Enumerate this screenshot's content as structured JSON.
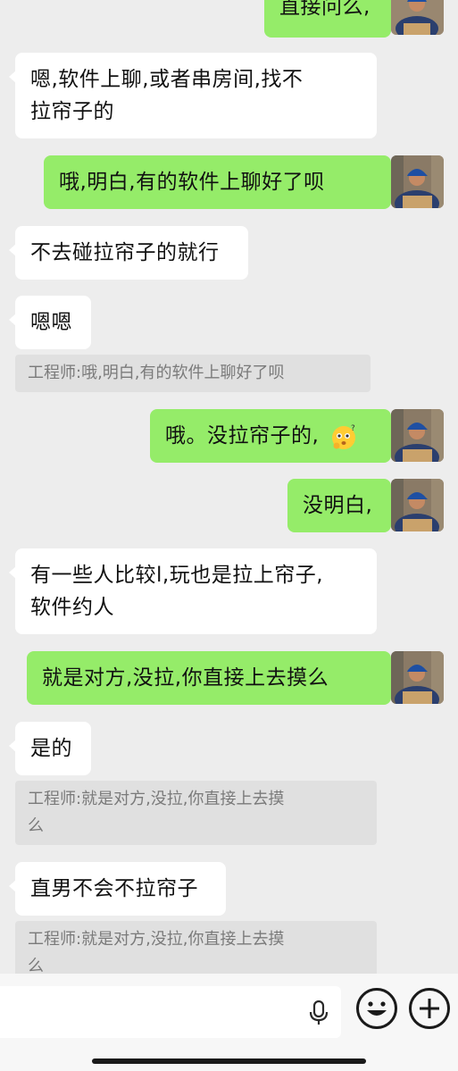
{
  "contacts": {
    "self_avatar": "person-with-blue-cap-holding-box-avatar"
  },
  "messages": [
    {
      "side": "out",
      "text": "直接问么,"
    },
    {
      "side": "in",
      "line1": "嗯,软件上聊,或者串房间,找不",
      "line2": "拉帘子的"
    },
    {
      "side": "out",
      "text": "哦,明白,有的软件上聊好了呗"
    },
    {
      "side": "in",
      "text": "不去碰拉帘子的就行"
    },
    {
      "side": "in",
      "text": "嗯嗯",
      "quote": "工程师:哦,明白,有的软件上聊好了呗"
    },
    {
      "side": "out",
      "text": "哦。没拉帘子的,",
      "emoji": "thinking-face-emoji"
    },
    {
      "side": "out",
      "text": "没明白,"
    },
    {
      "side": "in",
      "line1": "有一些人比较l,玩也是拉上帘子,",
      "line2": "软件约人"
    },
    {
      "side": "out",
      "text": "就是对方,没拉,你直接上去摸么"
    },
    {
      "side": "in",
      "text": "是的",
      "quote_line1": "工程师:就是对方,没拉,你直接上去摸",
      "quote_line2": "么"
    },
    {
      "side": "in",
      "text": "直男不会不拉帘子",
      "quote_line1": "工程师:就是对方,没拉,你直接上去摸",
      "quote_line2": "么"
    }
  ],
  "input": {
    "value": "",
    "icons": [
      "microphone-icon",
      "emoji-face-icon",
      "plus-icon"
    ]
  },
  "colors": {
    "incoming": "#ffffff",
    "outgoing": "#95ec69",
    "background": "#ededed"
  }
}
